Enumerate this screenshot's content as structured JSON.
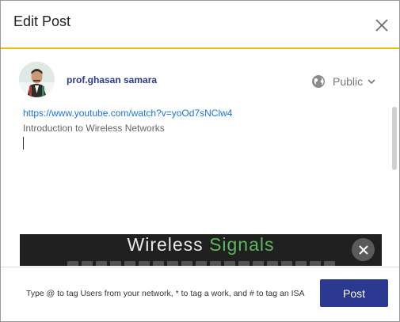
{
  "dialog": {
    "title": "Edit Post",
    "close_icon": "close-icon"
  },
  "author": {
    "name": "prof.ghasan samara",
    "avatar_icon": "avatar"
  },
  "privacy": {
    "label": "Public",
    "icon": "globe-icon"
  },
  "editor": {
    "link": "https://www.youtube.com/watch?v=yoOd7sNClw4",
    "description": "Introduction to Wireless Networks"
  },
  "preview": {
    "title_part1": "Wireless ",
    "title_part2": "Signals",
    "remove_icon": "close-icon"
  },
  "footer": {
    "hint": "Type @ to tag Users from your network, * to tag a work, and # to tag an ISA",
    "post_label": "Post"
  },
  "colors": {
    "accent": "#2b3990",
    "header_border": "#f2b90f",
    "link": "#1a73e8"
  }
}
